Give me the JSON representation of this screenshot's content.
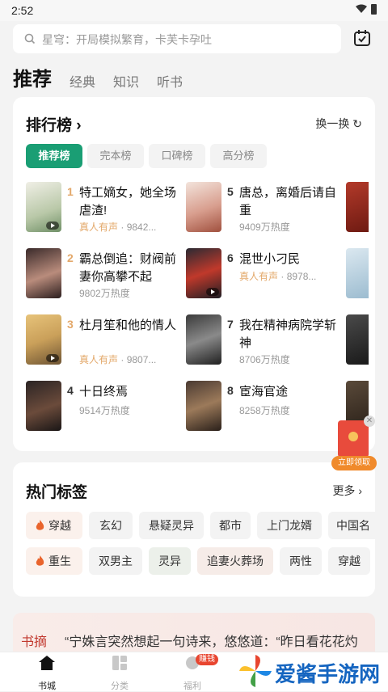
{
  "status": {
    "time": "2:52"
  },
  "search": {
    "placeholder": "星穹：开局模拟繁育，卡芙卡孕吐"
  },
  "tabs": [
    {
      "label": "推荐"
    },
    {
      "label": "经典"
    },
    {
      "label": "知识"
    },
    {
      "label": "听书"
    }
  ],
  "ranking": {
    "title": "排行榜",
    "refresh_label": "换一换",
    "filters": [
      "推荐榜",
      "完本榜",
      "口碑榜",
      "高分榜"
    ],
    "books": [
      {
        "rank": "1",
        "title": "特工嫡女，她全场虐渣!",
        "voice": "真人有声",
        "heat": "9842..."
      },
      {
        "rank": "2",
        "title": "霸总倒追：财阀前妻你高攀不起",
        "heat": "9802万热度"
      },
      {
        "rank": "3",
        "title": "杜月笙和他的情人",
        "voice": "真人有声",
        "heat": "9807..."
      },
      {
        "rank": "4",
        "title": "十日终焉",
        "heat": "9514万热度"
      },
      {
        "rank": "5",
        "title": "唐总，离婚后请自重",
        "heat": "9409万热度"
      },
      {
        "rank": "6",
        "title": "混世小刁民",
        "voice": "真人有声",
        "heat": "8978..."
      },
      {
        "rank": "7",
        "title": "我在精神病院学斩神",
        "heat": "8706万热度"
      },
      {
        "rank": "8",
        "title": "宦海官途",
        "heat": "8258万热度"
      }
    ]
  },
  "hot_tags": {
    "title": "热门标签",
    "more_label": "更多",
    "row1": [
      "穿越",
      "玄幻",
      "悬疑灵异",
      "都市",
      "上门龙婿",
      "中国名"
    ],
    "row2": [
      "重生",
      "双男主",
      "灵异",
      "追妻火葬场",
      "两性",
      "穿越"
    ]
  },
  "excerpt": {
    "label": "书摘",
    "text": "“宁姝言突然想起一句诗来，悠悠道：“昨日看花花灼"
  },
  "red_packet": {
    "cta": "立即领取"
  },
  "bottom_nav": [
    {
      "label": "书城"
    },
    {
      "label": "分类"
    },
    {
      "label": "福利",
      "badge": "赚钱"
    }
  ],
  "watermark": {
    "text": "爱酱手游网"
  }
}
